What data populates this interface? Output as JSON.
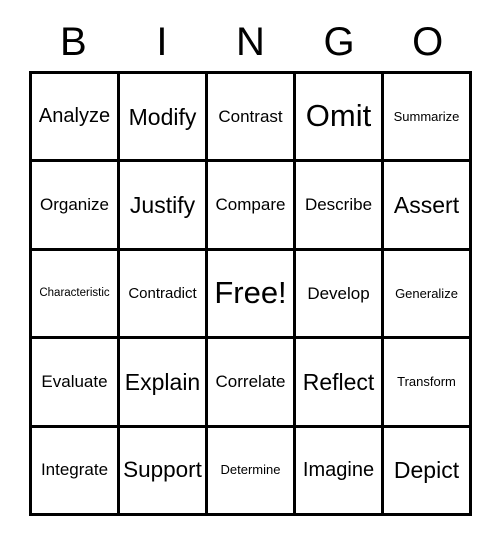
{
  "card": {
    "title": "Bingo Card",
    "header": {
      "letters": [
        "B",
        "I",
        "N",
        "G",
        "O"
      ]
    },
    "grid": {
      "rows": 5,
      "columns": 5,
      "free_space": "Free!",
      "free_space_position": {
        "row": 3,
        "column": 3
      },
      "cells": [
        [
          {
            "label": "Analyze",
            "size": "l"
          },
          {
            "label": "Modify",
            "size": "xl"
          },
          {
            "label": "Contrast",
            "size": "m"
          },
          {
            "label": "Omit",
            "size": "xxl"
          },
          {
            "label": "Summarize",
            "size": "xs"
          }
        ],
        [
          {
            "label": "Organize",
            "size": "m"
          },
          {
            "label": "Justify",
            "size": "xl"
          },
          {
            "label": "Compare",
            "size": "m"
          },
          {
            "label": "Describe",
            "size": "m"
          },
          {
            "label": "Assert",
            "size": "xl"
          }
        ],
        [
          {
            "label": "Characteristic",
            "size": "xxs"
          },
          {
            "label": "Contradict",
            "size": "s"
          },
          {
            "label": "Free!",
            "size": "xxl"
          },
          {
            "label": "Develop",
            "size": "m"
          },
          {
            "label": "Generalize",
            "size": "xs"
          }
        ],
        [
          {
            "label": "Evaluate",
            "size": "m"
          },
          {
            "label": "Explain",
            "size": "xl"
          },
          {
            "label": "Correlate",
            "size": "m"
          },
          {
            "label": "Reflect",
            "size": "xl"
          },
          {
            "label": "Transform",
            "size": "xs"
          }
        ],
        [
          {
            "label": "Integrate",
            "size": "m"
          },
          {
            "label": "Support",
            "size": "xl"
          },
          {
            "label": "Determine",
            "size": "xs"
          },
          {
            "label": "Imagine",
            "size": "l"
          },
          {
            "label": "Depict",
            "size": "xl"
          }
        ]
      ]
    },
    "colors": {
      "background": "#ffffff",
      "text": "#000000",
      "border": "#000000"
    }
  }
}
